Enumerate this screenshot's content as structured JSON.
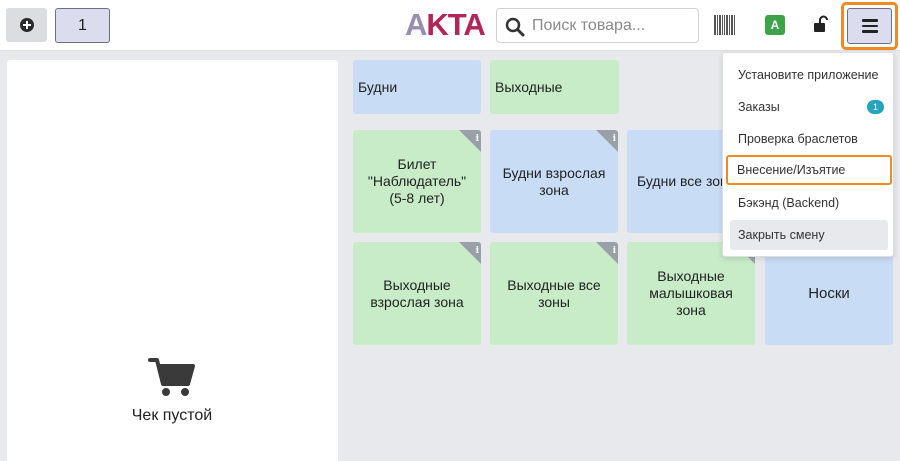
{
  "header": {
    "tab_number": "1",
    "logo_first": "A",
    "logo_rest": "KTA",
    "search_placeholder": "Поиск товара...",
    "user_badge": "A"
  },
  "categories": [
    {
      "label": "Будни",
      "color": "#c9dcf6"
    },
    {
      "label": "Выходные",
      "color": "#c8ebc8"
    }
  ],
  "products": [
    {
      "label": "Билет \"Наблюдатель\" (5-8 лет)",
      "info": "i"
    },
    {
      "label": "Будни взрослая зона",
      "info": "i"
    },
    {
      "label": "Будни все зоны",
      "info": "i"
    },
    {
      "label": "Выходные взрослая зона",
      "info": "i"
    },
    {
      "label": "Выходные все зоны",
      "info": "i"
    },
    {
      "label": "Выходные малышковая зона",
      "info": "i"
    },
    {
      "label": "Носки"
    }
  ],
  "menu": {
    "items": [
      {
        "label": "Установите приложение"
      },
      {
        "label": "Заказы",
        "badge": "1"
      },
      {
        "label": "Проверка браслетов"
      },
      {
        "label": "Внесение/Изъятие"
      },
      {
        "label": "Бэкэнд (Backend)"
      },
      {
        "label": "Закрыть смену"
      }
    ]
  },
  "cart": {
    "empty_text": "Чек пустой"
  },
  "colors": {
    "highlight": "#f08a22",
    "tile_green": "#c8ebc8",
    "tile_blue": "#c9dcf6",
    "badge_green": "#3da34a",
    "badge_blue": "#24a4bd",
    "logo_red": "#b3245a"
  }
}
